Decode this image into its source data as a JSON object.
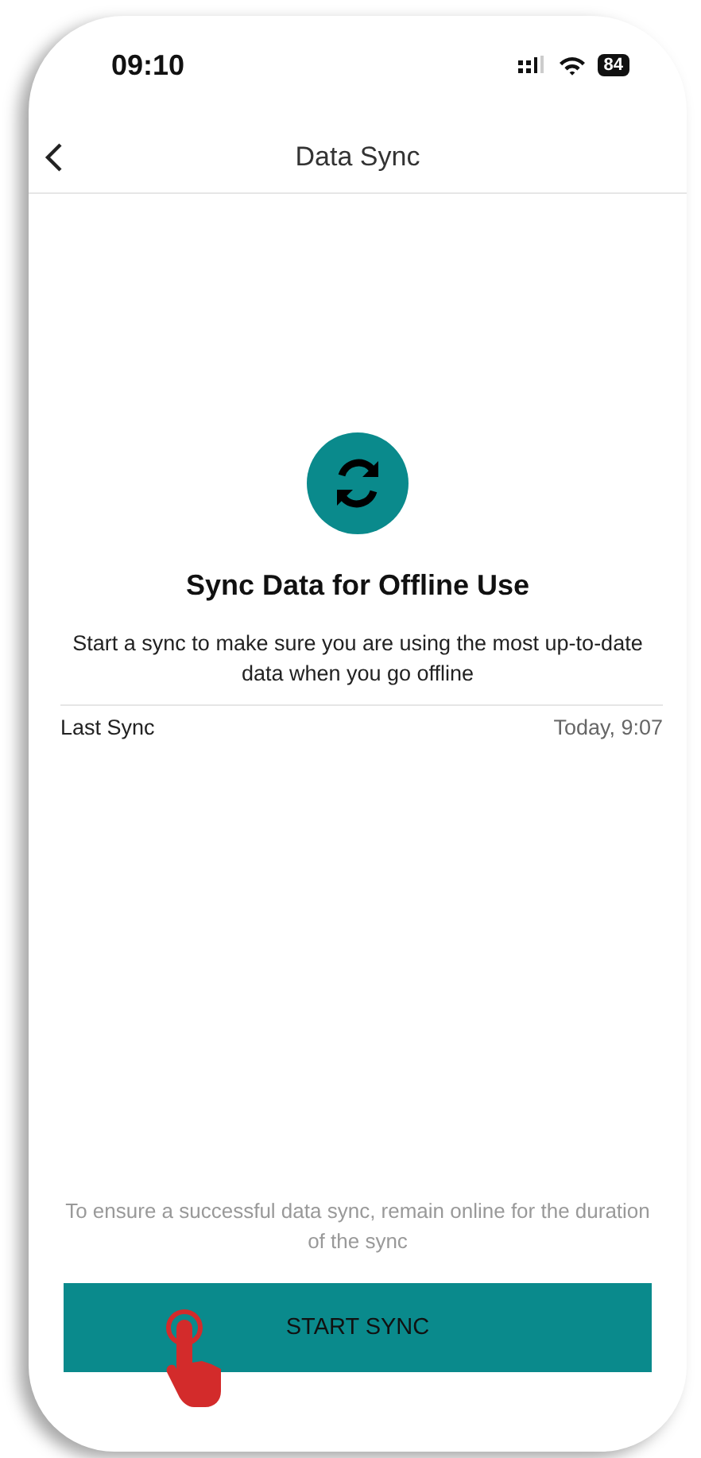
{
  "status_bar": {
    "time": "09:10",
    "battery": "84"
  },
  "nav": {
    "title": "Data Sync"
  },
  "heading": "Sync Data for Offline Use",
  "description": "Start a sync to make sure you are using the most up-to-date data when you go offline",
  "last_sync": {
    "label": "Last Sync",
    "value": "Today, 9:07"
  },
  "note": "To ensure a successful data sync, remain online for the duration of the sync",
  "button": {
    "label": "START SYNC"
  }
}
